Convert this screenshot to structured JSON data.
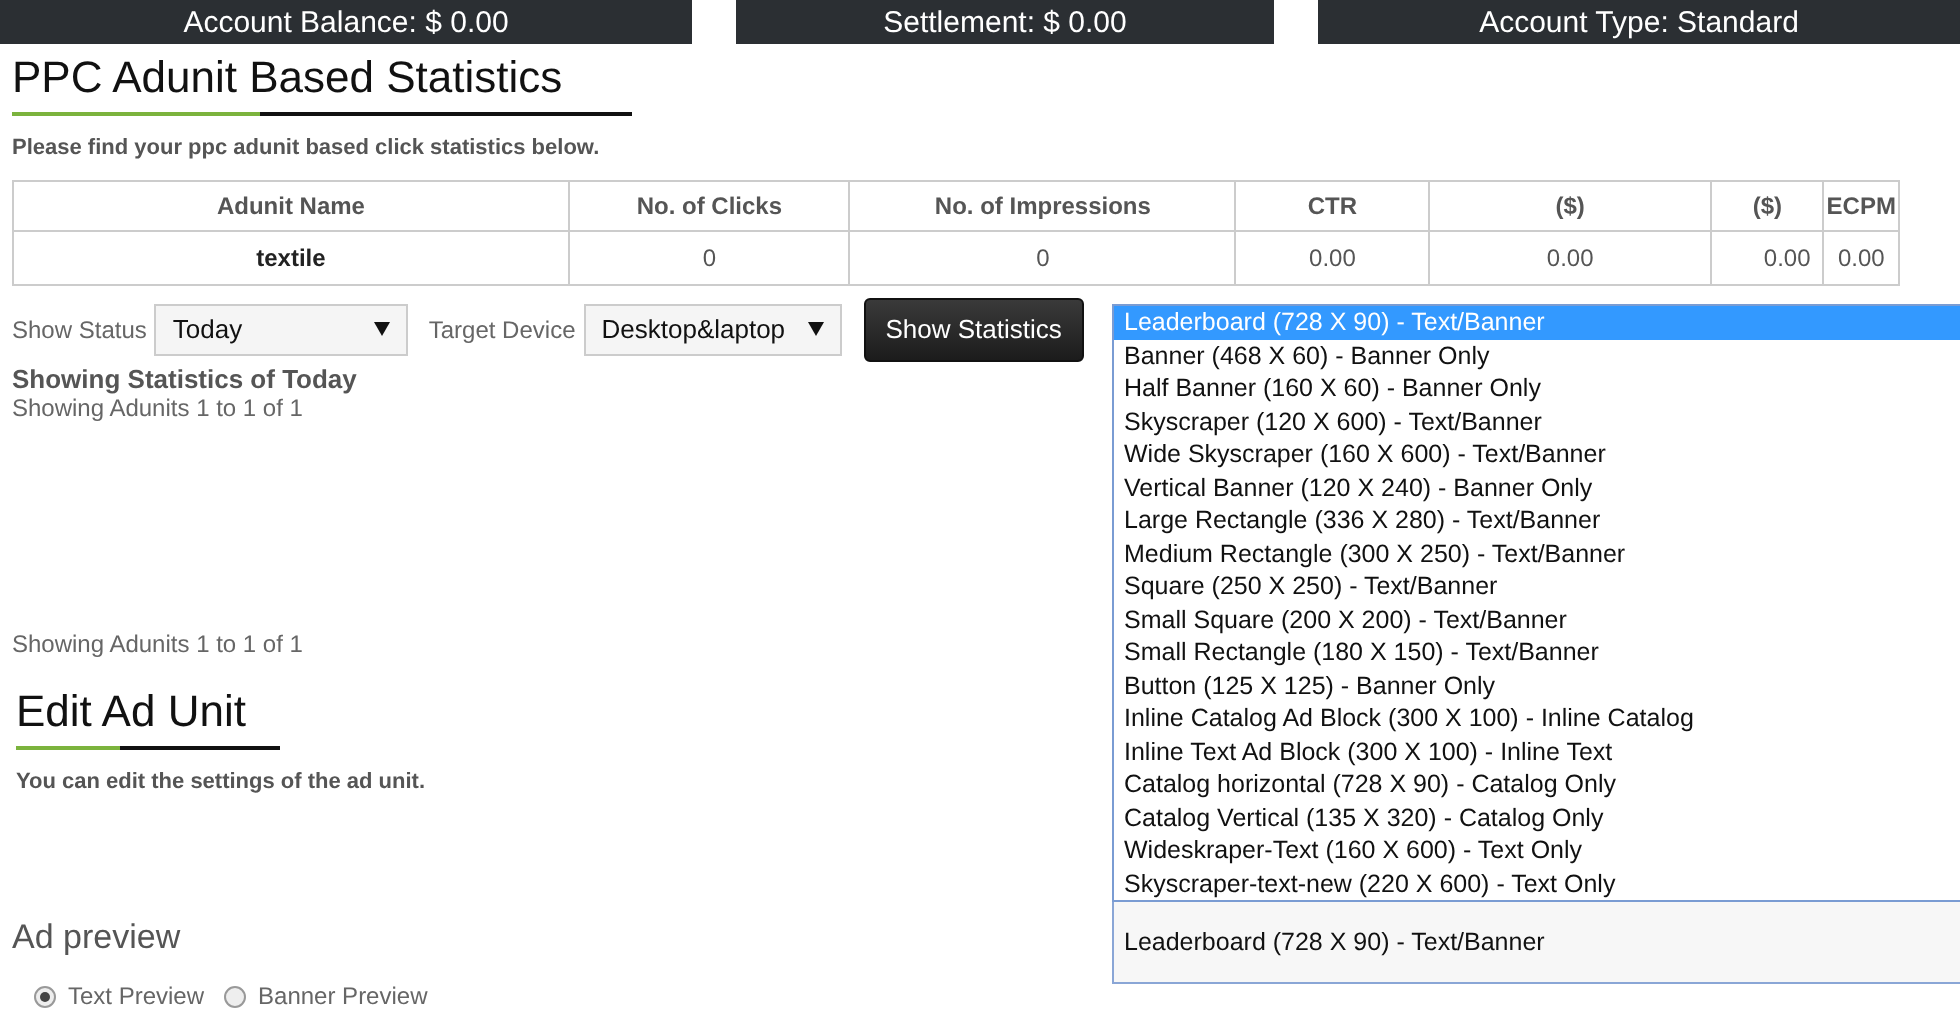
{
  "summary_bar": [
    {
      "label": "Account Balance: $ 0.00"
    },
    {
      "label": "Settlement: $ 0.00"
    },
    {
      "label": "Account Type: Standard"
    }
  ],
  "stats_section": {
    "title": "PPC Adunit Based Statistics",
    "description": "Please find your ppc adunit based click statistics below.",
    "table": {
      "columns": [
        "Adunit Name",
        "No. of Clicks",
        "No. of Impressions",
        "CTR",
        "($)",
        "($)",
        "ECPM"
      ],
      "rows": [
        [
          "textile",
          "0",
          "0",
          "0.00",
          "0.00",
          "0.00",
          "0.00"
        ]
      ]
    }
  },
  "filters": {
    "show_status": {
      "label": "Show Status",
      "value": "Today"
    },
    "target_device": {
      "label": "Target Device",
      "value": "Desktop&laptop"
    },
    "button": "Show Statistics"
  },
  "results": {
    "heading": "Showing Statistics of Today",
    "count_top": "Showing Adunits 1 to 1 of 1",
    "count_bottom": "Showing Adunits 1 to 1 of 1"
  },
  "edit_section": {
    "title": "Edit Ad Unit",
    "description": "You can edit the settings of the ad unit."
  },
  "ad_unit_dropdown": {
    "value": "Leaderboard (728 X 90) - Text/Banner",
    "options": [
      {
        "label": "Leaderboard (728 X 90) - Text/Banner",
        "selected": true
      },
      {
        "label": "Banner (468 X 60) - Banner Only",
        "selected": false
      },
      {
        "label": "Half Banner (160 X 60) - Banner Only",
        "selected": false
      },
      {
        "label": "Skyscraper (120 X 600) - Text/Banner",
        "selected": false
      },
      {
        "label": "Wide Skyscraper (160 X 600) - Text/Banner",
        "selected": false
      },
      {
        "label": "Vertical Banner (120 X 240) - Banner Only",
        "selected": false
      },
      {
        "label": "Large Rectangle (336 X 280) - Text/Banner",
        "selected": false
      },
      {
        "label": "Medium Rectangle (300 X 250) - Text/Banner",
        "selected": false
      },
      {
        "label": "Square (250 X 250) - Text/Banner",
        "selected": false
      },
      {
        "label": "Small Square (200 X 200) - Text/Banner",
        "selected": false
      },
      {
        "label": "Small Rectangle (180 X 150) - Text/Banner",
        "selected": false
      },
      {
        "label": "Button (125 X 125) - Banner Only",
        "selected": false
      },
      {
        "label": "Inline Catalog Ad Block (300 X 100) - Inline Catalog",
        "selected": false
      },
      {
        "label": "Inline Text Ad Block (300 X 100) - Inline Text",
        "selected": false
      },
      {
        "label": "Catalog horizontal (728 X 90) - Catalog Only",
        "selected": false
      },
      {
        "label": "Catalog Vertical (135 X 320) - Catalog Only",
        "selected": false
      },
      {
        "label": "Wideskraper-Text (160 X 600) - Text Only",
        "selected": false
      },
      {
        "label": "Skyscraper-text-new (220 X 600) - Text Only",
        "selected": false
      }
    ]
  },
  "ad_preview": {
    "title": "Ad preview",
    "options": [
      {
        "label": "Text Preview",
        "selected": true
      },
      {
        "label": "Banner Preview",
        "selected": false
      }
    ]
  }
}
